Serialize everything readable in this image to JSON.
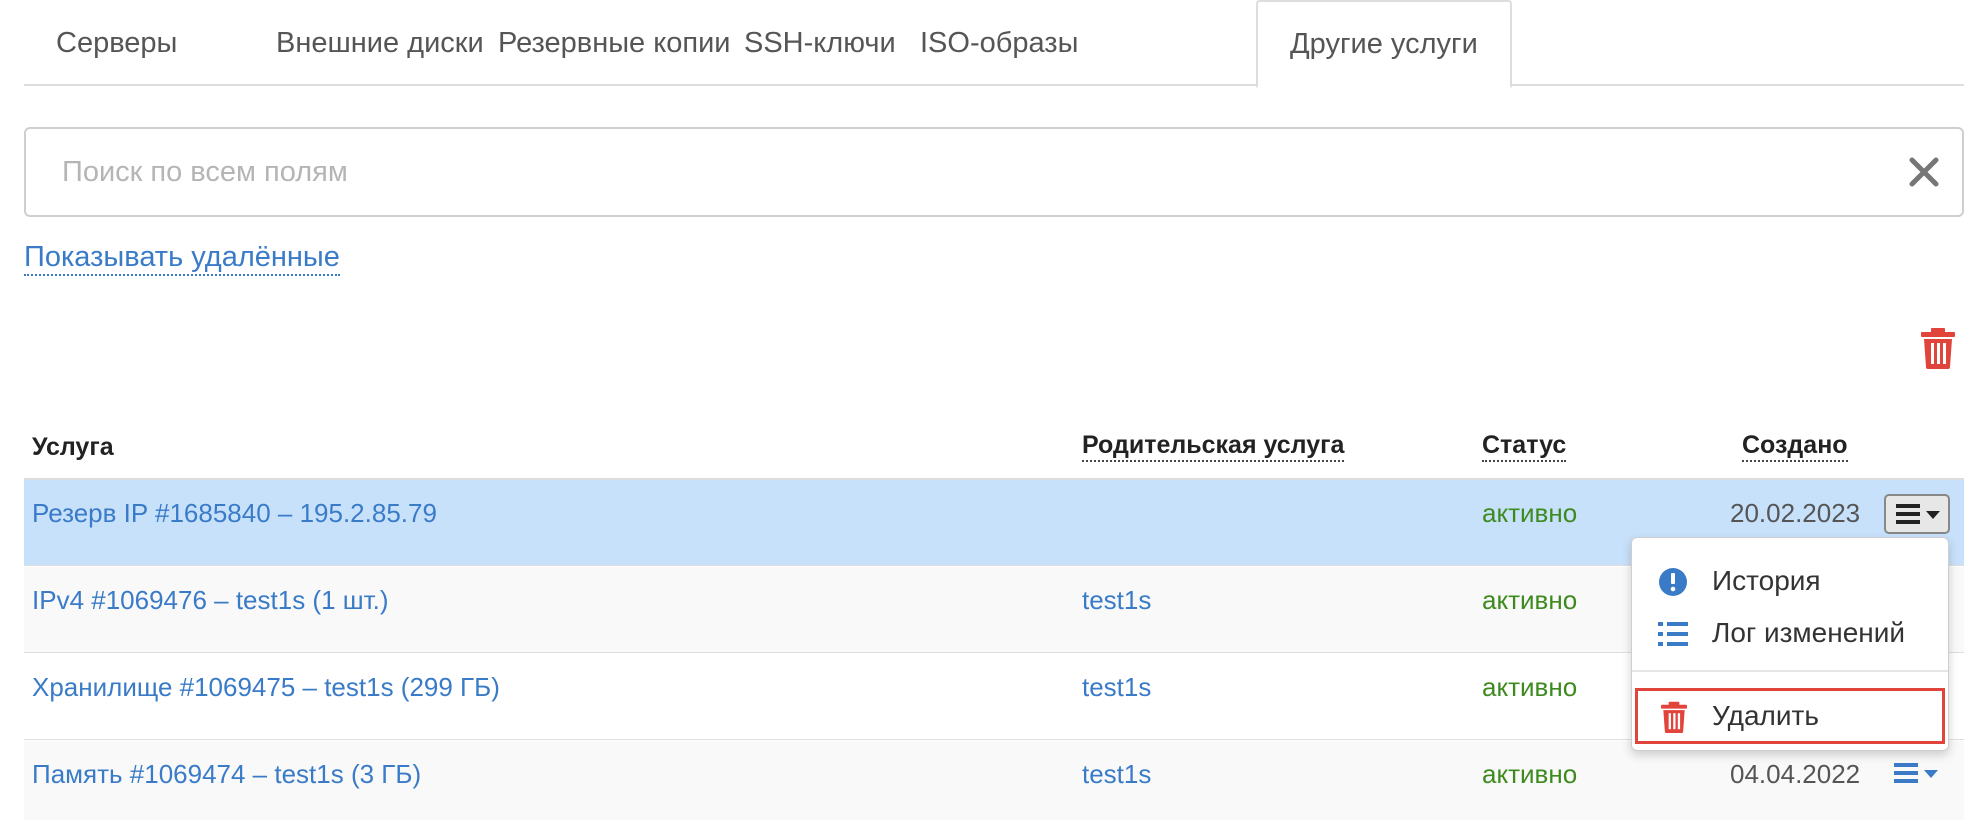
{
  "tabs": [
    {
      "label": "Серверы",
      "active": false
    },
    {
      "label": "Внешние диски",
      "active": false
    },
    {
      "label": "Резервные копии",
      "active": false
    },
    {
      "label": "SSH-ключи",
      "active": false
    },
    {
      "label": "ISO-образы",
      "active": false
    },
    {
      "label": "Другие услуги",
      "active": true
    }
  ],
  "search": {
    "placeholder": "Поиск по всем полям",
    "value": ""
  },
  "show_deleted_label": "Показывать удалённые",
  "table": {
    "columns": {
      "service": "Услуга",
      "parent": "Родительская услуга",
      "status": "Статус",
      "created": "Создано"
    },
    "rows": [
      {
        "service": "Резерв IP #1685840 – 195.2.85.79",
        "parent": "",
        "status": "активно",
        "created": "20.02.2023",
        "selected": true
      },
      {
        "service": "IPv4 #1069476 – test1s (1 шт.)",
        "parent": "test1s",
        "status": "активно",
        "created": "",
        "selected": false
      },
      {
        "service": "Хранилище #1069475 – test1s (299 ГБ)",
        "parent": "test1s",
        "status": "активно",
        "created": "",
        "selected": false
      },
      {
        "service": "Память #1069474 – test1s (3 ГБ)",
        "parent": "test1s",
        "status": "активно",
        "created": "04.04.2022",
        "selected": false
      }
    ]
  },
  "dropdown": {
    "items": [
      {
        "label": "История",
        "icon": "exclamation-circle-icon"
      },
      {
        "label": "Лог изменений",
        "icon": "list-icon"
      },
      {
        "label": "Удалить",
        "icon": "trash-icon",
        "highlighted": true
      }
    ]
  },
  "colors": {
    "link": "#3a7bc8",
    "status_active": "#3d8a1f",
    "selected_row": "#c8e1fb",
    "danger": "#e0443a"
  }
}
